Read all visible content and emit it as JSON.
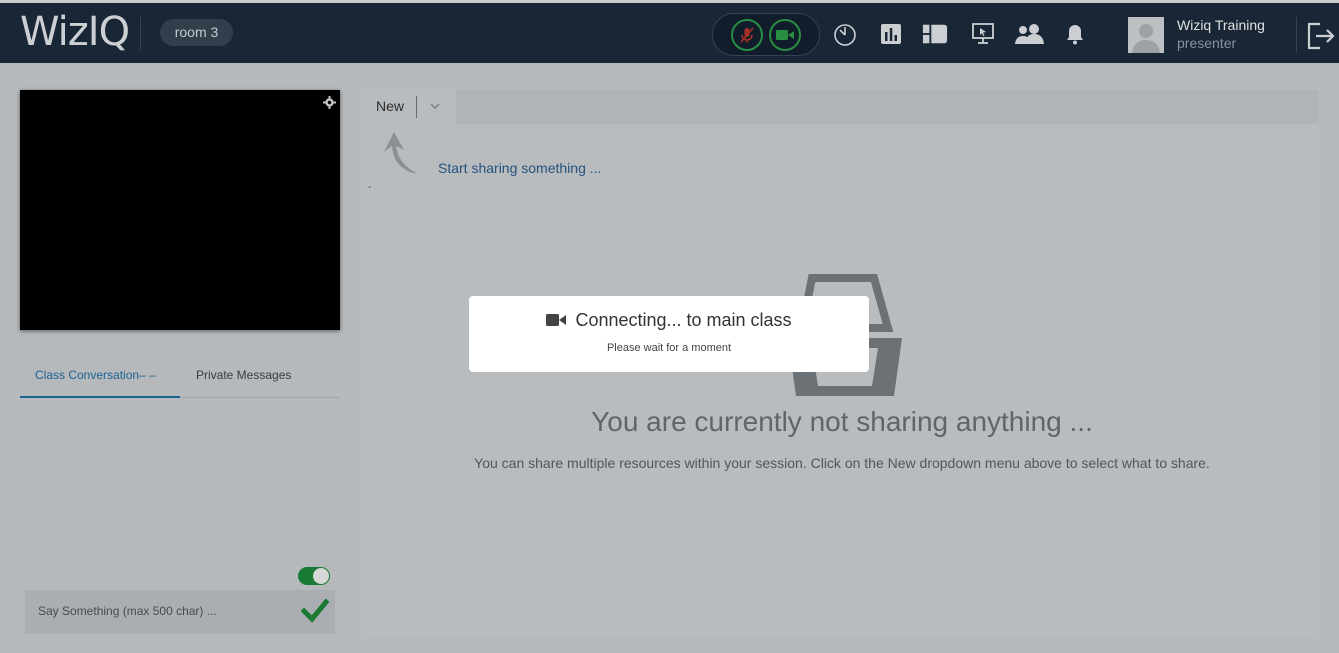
{
  "header": {
    "logo": "WizIQ",
    "room_label": "room 3",
    "user": {
      "name": "Wiziq Training",
      "role": "presenter"
    },
    "tools": [
      "mic-muted-icon",
      "camera-icon",
      "timer-icon",
      "poll-icon",
      "content-icon",
      "screen-share-icon",
      "participants-icon",
      "bell-icon",
      "logout-icon"
    ]
  },
  "chat": {
    "tabs": [
      {
        "label": "Class Conversation– –"
      },
      {
        "label": "Private Messages"
      }
    ],
    "input_placeholder": "Say Something (max 500 char) ..."
  },
  "stage": {
    "tab_label": "New",
    "start_sharing": "Start sharing something ...",
    "dash": "-",
    "empty_title": "You are currently not sharing anything ...",
    "empty_hint": "You can share multiple resources within your session. Click on the New dropdown menu above to select what to share."
  },
  "modal": {
    "title": "Connecting... to main class",
    "subtitle": "Please wait for a moment"
  },
  "colors": {
    "topbar": "#1d2c3e",
    "accent_green": "#2ea24c",
    "link_blue": "#2a5f91"
  }
}
